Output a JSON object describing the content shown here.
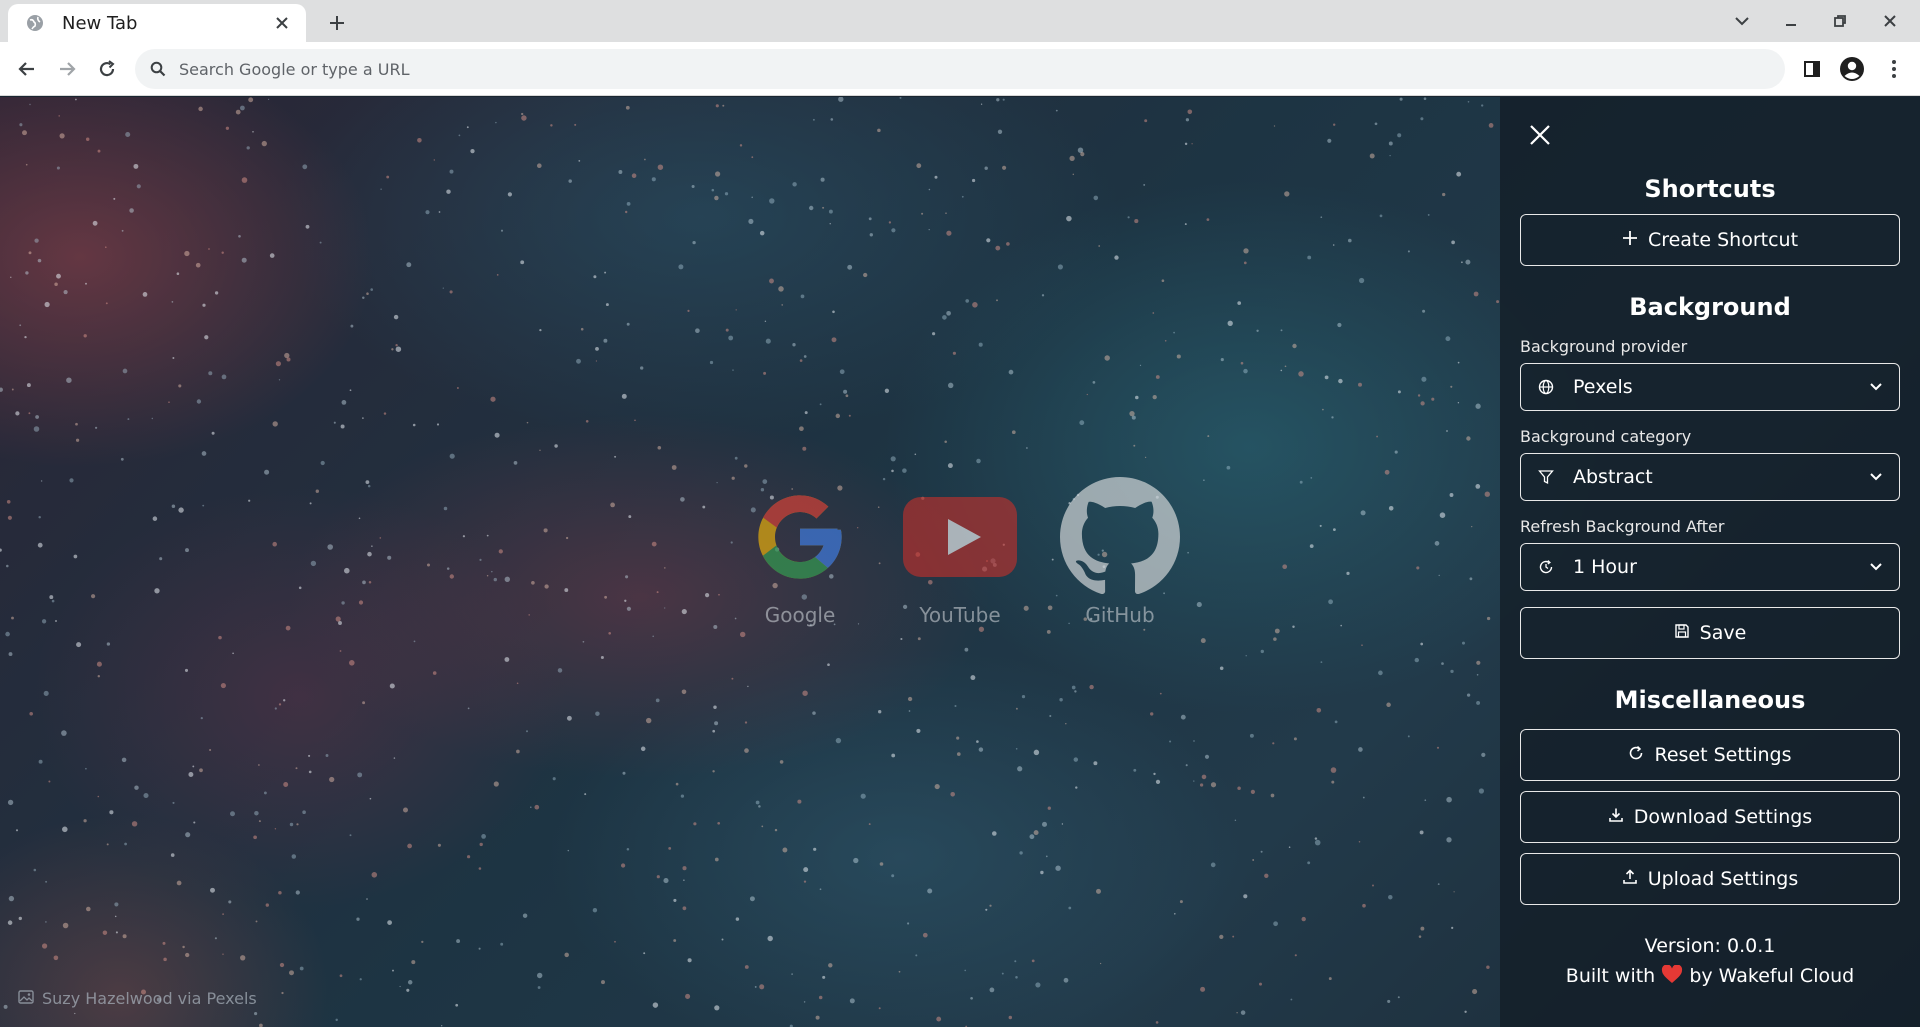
{
  "browser": {
    "tab_title": "New Tab",
    "omnibox_placeholder": "Search Google or type a URL"
  },
  "shortcuts": [
    {
      "label": "Google"
    },
    {
      "label": "YouTube"
    },
    {
      "label": "GitHub"
    }
  ],
  "photo_credit": "Suzy Hazelwood via Pexels",
  "panel": {
    "shortcuts_title": "Shortcuts",
    "create_shortcut_label": "Create Shortcut",
    "background_title": "Background",
    "provider_label": "Background provider",
    "provider_value": "Pexels",
    "category_label": "Background category",
    "category_value": "Abstract",
    "refresh_label": "Refresh Background After",
    "refresh_value": "1 Hour",
    "save_label": "Save",
    "misc_title": "Miscellaneous",
    "reset_label": "Reset Settings",
    "download_label": "Download Settings",
    "upload_label": "Upload Settings",
    "version_text": "Version: 0.0.1",
    "built_prefix": "Built with",
    "built_suffix": "by Wakeful Cloud"
  },
  "colors": {
    "panel_bg": "#141e28",
    "heart": "#e53935",
    "youtube_red": "#c4302b",
    "google_blue": "#4285F4",
    "google_red": "#EA4335",
    "google_yellow": "#FBBC05",
    "google_green": "#34A853"
  }
}
